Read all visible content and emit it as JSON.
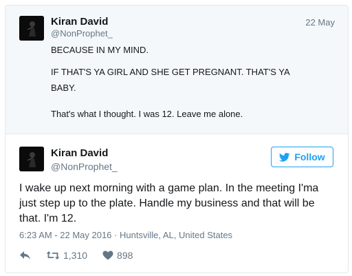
{
  "parent_tweet": {
    "name": "Kiran David",
    "handle": "@NonProphet_",
    "date": "22 May",
    "lines": [
      "BECAUSE IN MY MIND.",
      "IF THAT'S YA GIRL AND SHE GET PREGNANT. THAT'S YA",
      "BABY.",
      "That's what I thought. I was 12. Leave me alone."
    ]
  },
  "main_tweet": {
    "name": "Kiran David",
    "handle": "@NonProphet_",
    "follow_label": "Follow",
    "text_lines": [
      "I wake up next morning with a game plan. In the meeting I'ma",
      "just step up to the plate. Handle my business and that will be",
      "that. I'm 12."
    ],
    "timestamp": "6:23 AM - 22 May 2016",
    "separator": "·",
    "location": "Huntsville, AL, United States",
    "retweet_count": "1,310",
    "like_count": "898"
  },
  "colors": {
    "accent": "#1da1f2",
    "secondary_text": "#657786",
    "parent_background": "#f5f8fa"
  },
  "icons": [
    "reply-icon",
    "retweet-icon",
    "heart-icon",
    "twitter-bird-icon"
  ]
}
